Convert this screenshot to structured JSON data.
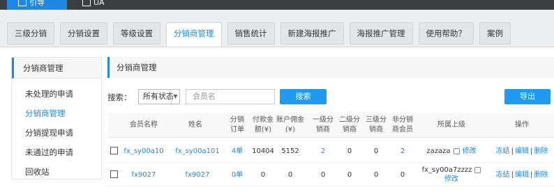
{
  "topbar": {
    "nav1": "引导",
    "nav2": "UA"
  },
  "tabs": [
    {
      "label": "三级分销"
    },
    {
      "label": "分销设置"
    },
    {
      "label": "等级设置"
    },
    {
      "label": "分销商管理"
    },
    {
      "label": "销售统计"
    },
    {
      "label": "新建海报推广"
    },
    {
      "label": "海报推广管理"
    },
    {
      "label": "使用帮助？"
    },
    {
      "label": "案例"
    }
  ],
  "sidebar": {
    "title": "分销商管理",
    "items": [
      {
        "label": "未处理的申请"
      },
      {
        "label": "分销商管理"
      },
      {
        "label": "分销提现申请"
      },
      {
        "label": "未通过的申请"
      },
      {
        "label": "回收站"
      }
    ]
  },
  "main": {
    "title": "分销商管理",
    "search": {
      "label": "搜索：",
      "status_value": "所有状态",
      "member_placeholder": "会员名",
      "search_button": "搜索",
      "export_button": "导出"
    },
    "columns": [
      "会员名称",
      "姓名",
      "分销订单",
      "付款金额(¥)",
      "账户佣金(¥)",
      "一级分销商",
      "二级分销商",
      "三级分销商",
      "非分销商会员",
      "所属上级",
      "操作"
    ],
    "rows": [
      {
        "member": "fx_sy00a10",
        "name": "fx_sy00a101",
        "orders": "4单",
        "paid": "10404",
        "commission": "5152",
        "l1": "2",
        "l2": "0",
        "l3": "0",
        "non": "2",
        "superior": "zazaza",
        "superior_action": "修改",
        "ops": [
          "冻结",
          "编辑",
          "删除"
        ]
      },
      {
        "member": "fx9027",
        "name": "fx9027",
        "orders": "0单",
        "paid": "0",
        "commission": "0",
        "l1": "0",
        "l2": "0",
        "l3": "0",
        "non": "0",
        "superior": "fx_sy00a7zzzz",
        "superior_action": "修改",
        "ops": [
          "冻结",
          "编辑",
          "删除"
        ]
      }
    ]
  }
}
